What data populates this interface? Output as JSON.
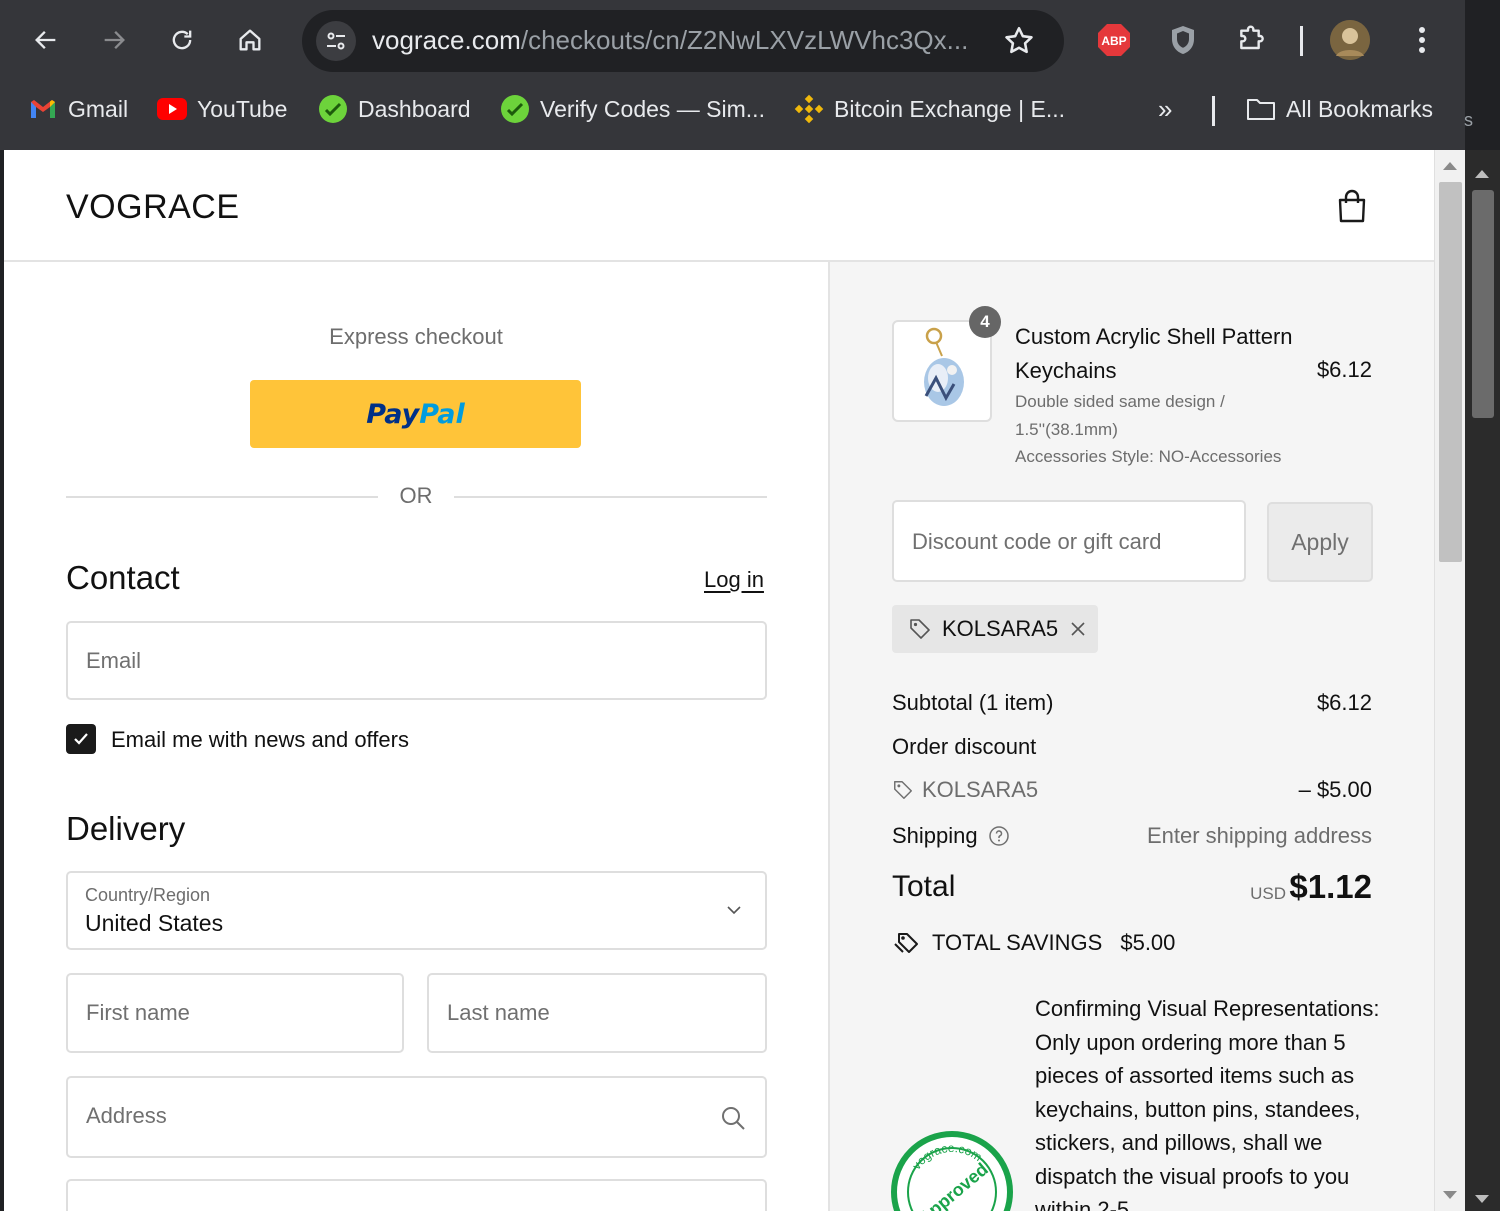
{
  "browser": {
    "url_host": "vograce.com",
    "url_path": "/checkouts/cn/Z2NwLXVzLWVhc3Qx...",
    "extension_abp": "ABP",
    "bookmarks": [
      {
        "label": "Gmail",
        "icon": "gmail-icon"
      },
      {
        "label": "YouTube",
        "icon": "youtube-icon"
      },
      {
        "label": "Dashboard",
        "icon": "dashboard-icon"
      },
      {
        "label": "Verify Codes — Sim...",
        "icon": "verify-codes-icon"
      },
      {
        "label": "Bitcoin Exchange | E...",
        "icon": "binance-icon"
      }
    ],
    "more_bookmarks": "»",
    "all_bookmarks": "All Bookmarks",
    "overflow_char": "s"
  },
  "header": {
    "store_name": "VOGRACE"
  },
  "express": {
    "title": "Express checkout",
    "paypal_part1": "Pay",
    "paypal_part2": "Pal",
    "or_text": "OR"
  },
  "contact": {
    "title": "Contact",
    "login_link": "Log in",
    "email_placeholder": "Email",
    "newsletter_label": "Email me with news and offers",
    "newsletter_checked": true
  },
  "delivery": {
    "title": "Delivery",
    "country_label": "Country/Region",
    "country_value": "United States",
    "first_name_placeholder": "First name",
    "last_name_placeholder": "Last name",
    "address_placeholder": "Address"
  },
  "summary": {
    "product": {
      "quantity": "4",
      "title": "Custom Acrylic Shell Pattern Keychains",
      "price": "$6.12",
      "variant_line1": "Double sided same design /",
      "variant_line2": "1.5''(38.1mm)",
      "variant_line3": "Accessories Style: NO-Accessories"
    },
    "discount_placeholder": "Discount code or gift card",
    "apply_label": "Apply",
    "applied_code": "KOLSARA5",
    "subtotal_label": "Subtotal (1 item)",
    "subtotal_value": "$6.12",
    "order_discount_label": "Order discount",
    "discount_code": "KOLSARA5",
    "discount_value": "– $5.00",
    "shipping_label": "Shipping",
    "shipping_value": "Enter shipping address",
    "total_label": "Total",
    "total_currency": "USD",
    "total_value": "$1.12",
    "savings_label": "TOTAL SAVINGS",
    "savings_value": "$5.00",
    "confirm_text": "Confirming Visual Representations: Only upon ordering more than 5 pieces of assorted items such as keychains, button pins, standees, stickers, and pillows, shall we dispatch the visual proofs to you within 2-5",
    "seal_text_top": "vograce.com",
    "seal_text_center": "Approved"
  },
  "colors": {
    "paypal_yellow": "#ffc439",
    "paypal_dark_blue": "#003087",
    "paypal_light_blue": "#009cde",
    "approved_green": "#1aa34a",
    "chrome_bg": "#35363a"
  }
}
